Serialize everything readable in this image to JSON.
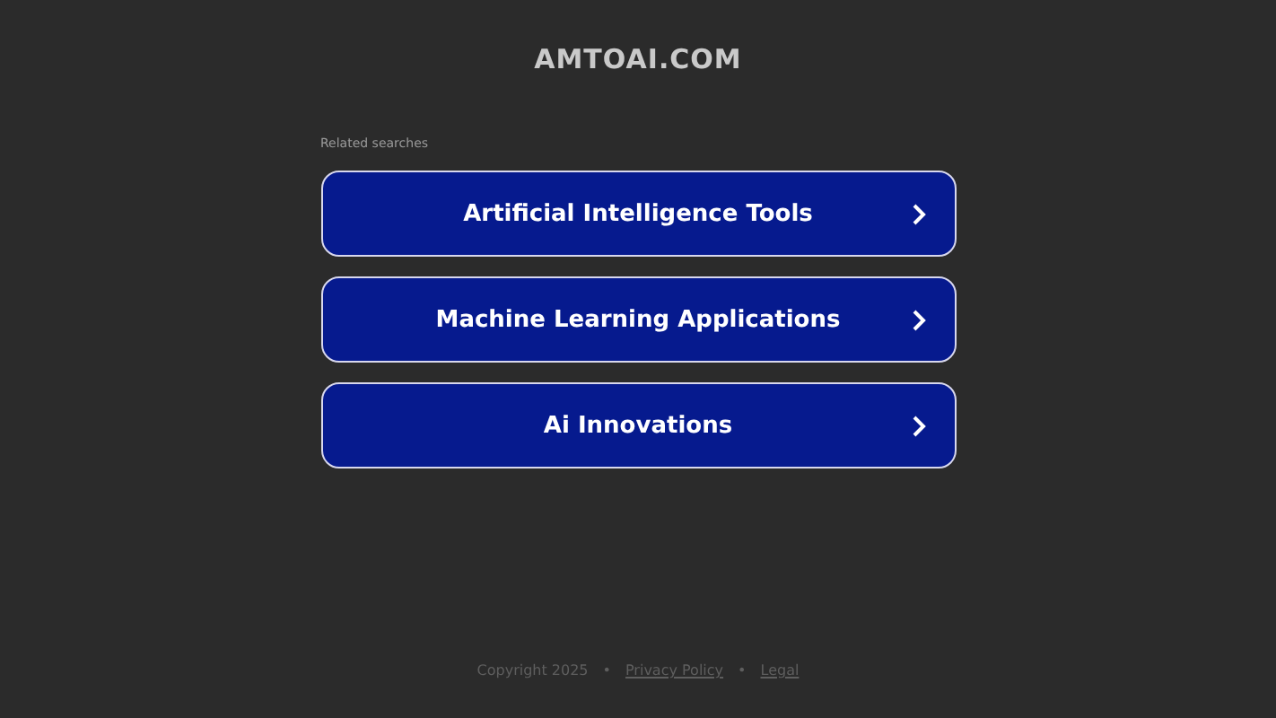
{
  "site_title": "AMTOAI.COM",
  "related_label": "Related searches",
  "searches": [
    {
      "label": "Artificial Intelligence Tools"
    },
    {
      "label": "Machine Learning Applications"
    },
    {
      "label": "Ai Innovations"
    }
  ],
  "footer": {
    "copyright": "Copyright 2025",
    "separator": "•",
    "links": [
      "Privacy Policy",
      "Legal"
    ]
  }
}
